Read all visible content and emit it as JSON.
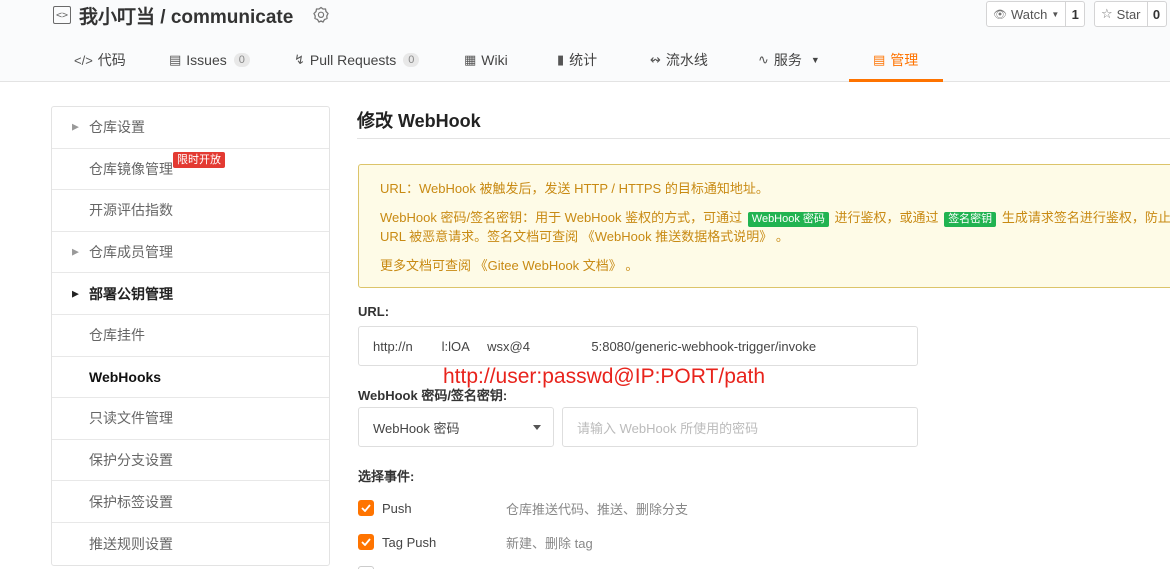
{
  "repo": {
    "name": "我小叮当 / communicate"
  },
  "watch": {
    "label": "Watch",
    "count": "1"
  },
  "star": {
    "label": "Star",
    "count": "0"
  },
  "tabs": [
    {
      "label": "代码",
      "icon": "code-icon"
    },
    {
      "label": "Issues",
      "icon": "issues-icon",
      "count": "0"
    },
    {
      "label": "Pull Requests",
      "icon": "pull-request-icon",
      "count": "0"
    },
    {
      "label": "Wiki",
      "icon": "wiki-icon"
    },
    {
      "label": "统计",
      "icon": "stats-icon"
    },
    {
      "label": "流水线",
      "icon": "pipeline-icon"
    },
    {
      "label": "服务",
      "icon": "service-icon"
    },
    {
      "label": "管理",
      "icon": "manage-icon"
    }
  ],
  "sidebar": {
    "items": [
      {
        "label": "仓库设置"
      },
      {
        "label": "仓库镜像管理",
        "tag": "限时开放"
      },
      {
        "label": "开源评估指数"
      },
      {
        "label": "仓库成员管理"
      },
      {
        "label": "部署公钥管理"
      },
      {
        "label": "仓库挂件"
      },
      {
        "label": "WebHooks"
      },
      {
        "label": "只读文件管理"
      },
      {
        "label": "保护分支设置"
      },
      {
        "label": "保护标签设置"
      },
      {
        "label": "推送规则设置"
      }
    ]
  },
  "main": {
    "title": "修改 WebHook",
    "notice": {
      "line1": "URL：WebHook 被触发后，发送 HTTP / HTTPS 的目标通知地址。",
      "line2_a": "WebHook 密码/签名密钥：用于 WebHook 鉴权的方式，可通过",
      "tag_password": "WebHook 密码",
      "line2_b": "进行鉴权，或通过",
      "tag_signature": "签名密钥",
      "line2_c": "生成请求签名进行鉴权，防止 URL 被恶意请求。签名文档可查阅",
      "link_format": "《WebHook 推送数据格式说明》",
      "line2_end": "。",
      "line3_a": "更多文档可查阅",
      "link_docs": "《Gitee WebHook 文档》",
      "line3_end": "。"
    },
    "url_label": "URL:",
    "url_value": "http://n        l:lOA     wsx@4                 5:8080/generic-webhook-trigger/invoke",
    "annotation": "http://user:passwd@IP:PORT/path",
    "secret_label": "WebHook 密码/签名密钥:",
    "secret_type": "WebHook 密码",
    "secret_placeholder": "请输入 WebHook 所使用的密码",
    "events_label": "选择事件:",
    "events": [
      {
        "name": "Push",
        "desc": "仓库推送代码、推送、删除分支"
      },
      {
        "name": "Tag Push",
        "desc": "新建、删除 tag"
      }
    ]
  },
  "colors": {
    "accent": "#fe7300",
    "notice_text": "#c88a13",
    "notice_bg": "#fefbe7",
    "tag_green": "#21b351",
    "annotation_red": "#e8231c"
  }
}
